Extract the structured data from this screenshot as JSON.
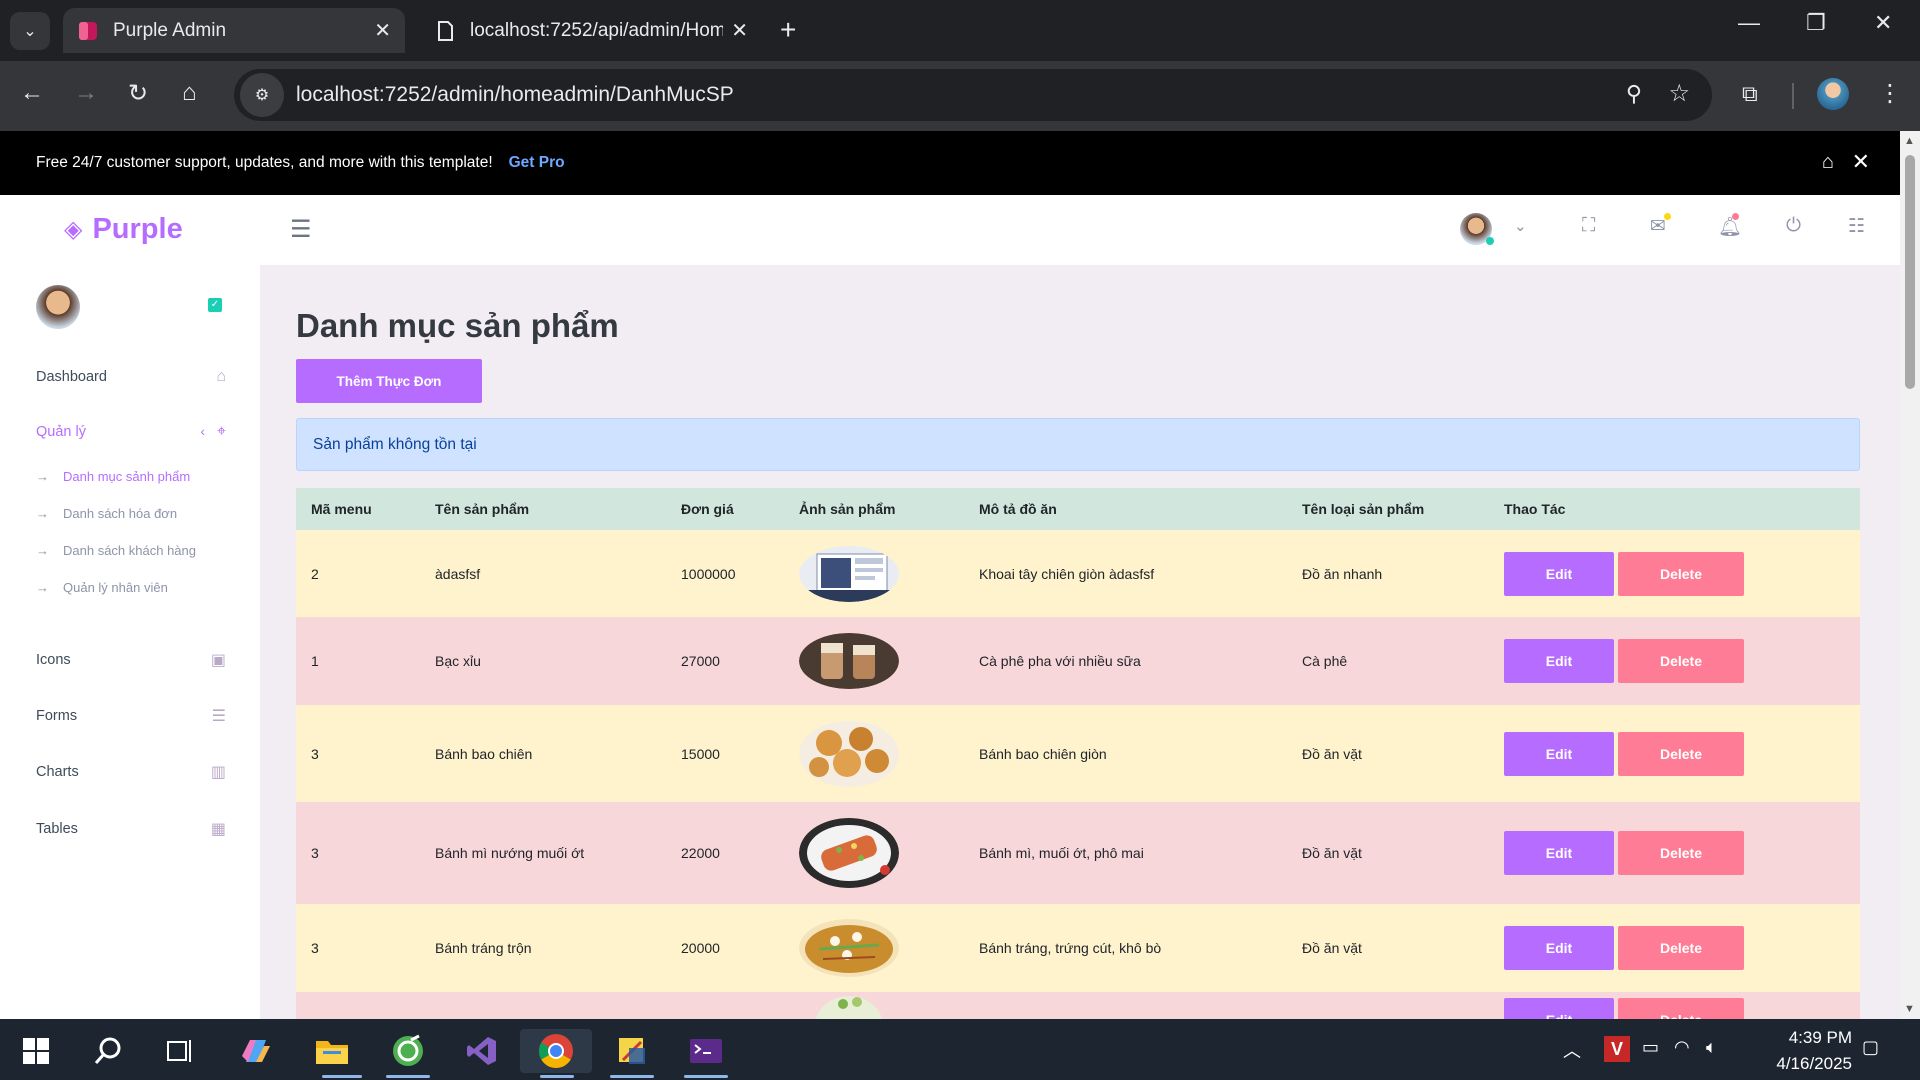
{
  "browser": {
    "tabs": [
      {
        "title": "Purple Admin",
        "active": true
      },
      {
        "title": "localhost:7252/api/admin/Hom",
        "active": false
      }
    ],
    "url": "localhost:7252/admin/homeadmin/DanhMucSP"
  },
  "promo": {
    "text": "Free 24/7 customer support, updates, and more with this template!",
    "link": "Get Pro"
  },
  "app": {
    "brand": "Purple"
  },
  "sidebar": {
    "items": [
      {
        "label": "Dashboard",
        "icon": "home-icon"
      },
      {
        "label": "Quản lý",
        "icon": "crosshairs-icon"
      },
      {
        "label": "Icons",
        "icon": "contacts-icon"
      },
      {
        "label": "Forms",
        "icon": "format-list-icon"
      },
      {
        "label": "Charts",
        "icon": "chart-bar-icon"
      },
      {
        "label": "Tables",
        "icon": "table-icon"
      }
    ],
    "submenu": [
      {
        "label": "Danh mục sảnh phẩm"
      },
      {
        "label": "Danh sách hóa đơn"
      },
      {
        "label": "Danh sách khách hàng"
      },
      {
        "label": "Quản lý nhân viên"
      }
    ]
  },
  "main": {
    "title": "Danh mục sản phẩm",
    "add_button": "Thêm Thực Đơn",
    "alert": "Sản phẩm không tồn tại",
    "columns": [
      "Mã menu",
      "Tên sản phẩm",
      "Đơn giá",
      "Ảnh sản phẩm",
      "Mô tả đồ ăn",
      "Tên loại sản phẩm",
      "Thao Tác"
    ],
    "rows": [
      {
        "id": "2",
        "name": "àdasfsf",
        "price": "1000000",
        "desc": "Khoai tây chiên giòn àdasfsf",
        "category": "Đồ ăn nhanh",
        "image": "screenshot-image"
      },
      {
        "id": "1",
        "name": "Bạc xỉu",
        "price": "27000",
        "desc": "Cà phê pha với nhiều sữa",
        "category": "Cà phê",
        "image": "coffee-image"
      },
      {
        "id": "3",
        "name": "Bánh bao chiên",
        "price": "15000",
        "desc": "Bánh bao chiên giòn",
        "category": "Đồ ăn vặt",
        "image": "fried-bun-image"
      },
      {
        "id": "3",
        "name": "Bánh mì nướng muối ớt",
        "price": "22000",
        "desc": "Bánh mì, muối ớt, phô mai",
        "category": "Đồ ăn vặt",
        "image": "grilled-bread-image"
      },
      {
        "id": "3",
        "name": "Bánh tráng trộn",
        "price": "20000",
        "desc": "Bánh tráng, trứng cút, khô bò",
        "category": "Đồ ăn vặt",
        "image": "rice-paper-salad-image"
      }
    ],
    "edit_label": "Edit",
    "delete_label": "Delete"
  },
  "taskbar": {
    "time": "4:39 PM",
    "date": "4/16/2025"
  },
  "colors": {
    "accent": "#b66dff",
    "danger": "#fe7c96",
    "row_odd": "#fff3cd",
    "row_even": "#f8d7da",
    "header_row": "#d1e7dd",
    "alert_bg": "#cfe2ff"
  }
}
